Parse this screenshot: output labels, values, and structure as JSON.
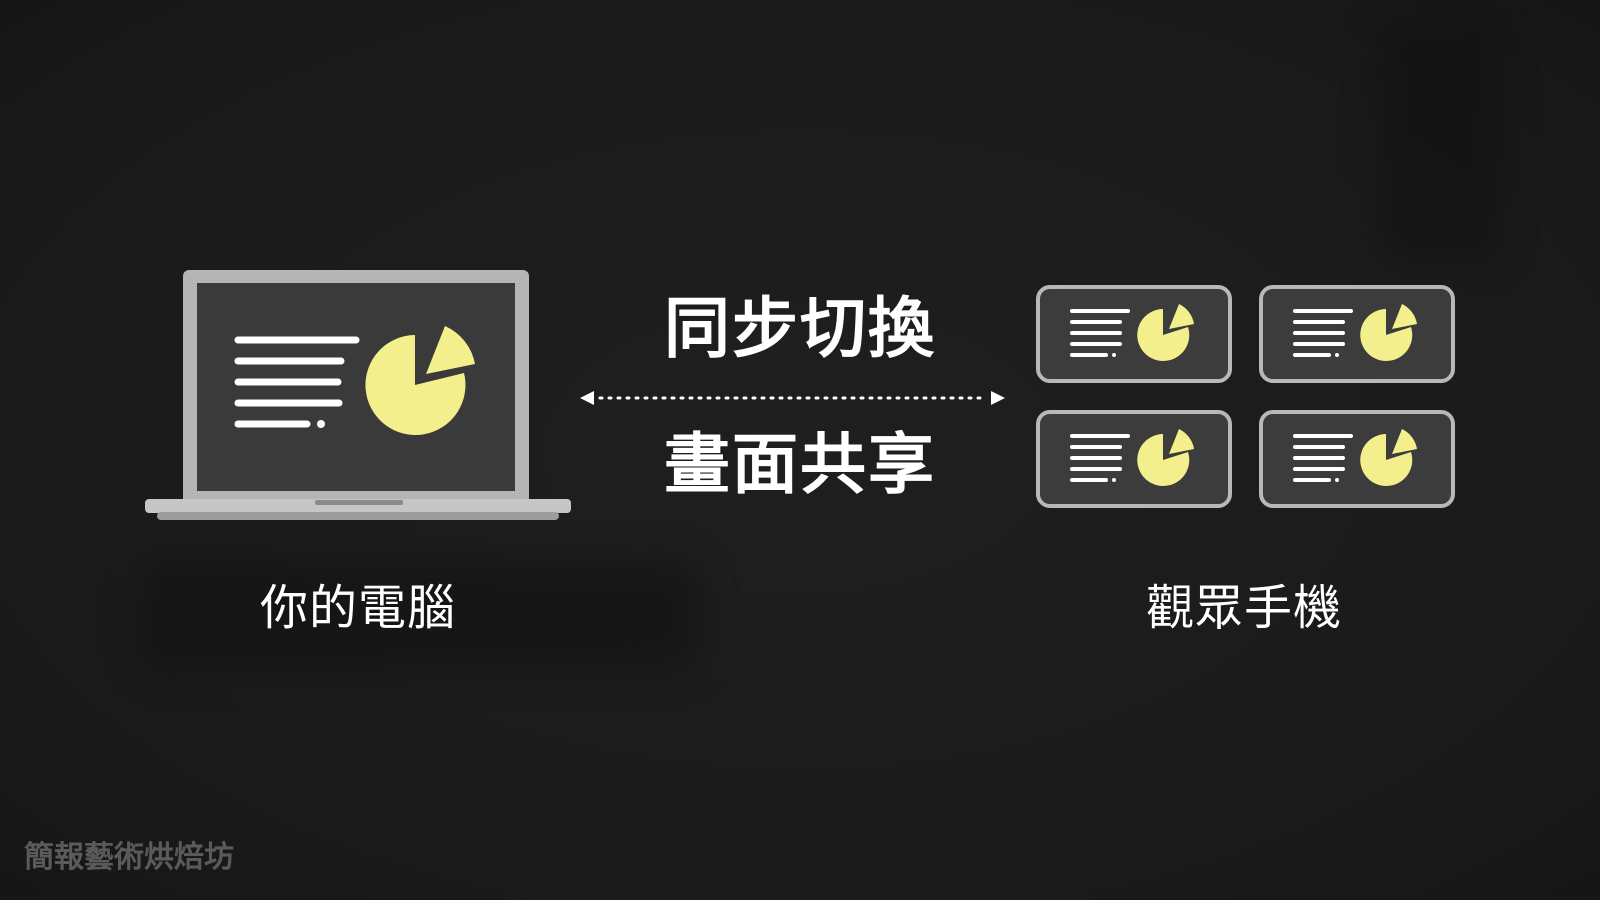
{
  "diagram": {
    "center_top_text": "同步切換",
    "center_bottom_text": "畫面共享",
    "left_caption": "你的電腦",
    "right_caption": "觀眾手機"
  },
  "watermark": "簡報藝術烘焙坊",
  "colors": {
    "background": "#1b1b1b",
    "screen": "#3a3a3a",
    "frame": "#b8b8b8",
    "accent_yellow": "#f2ef8c",
    "text": "#ffffff",
    "watermark": "#5a5a5a"
  },
  "icons": {
    "laptop": "laptop-icon",
    "phone": "phone-icon",
    "pie": "pie-chart-icon",
    "arrow": "double-arrow-icon"
  }
}
